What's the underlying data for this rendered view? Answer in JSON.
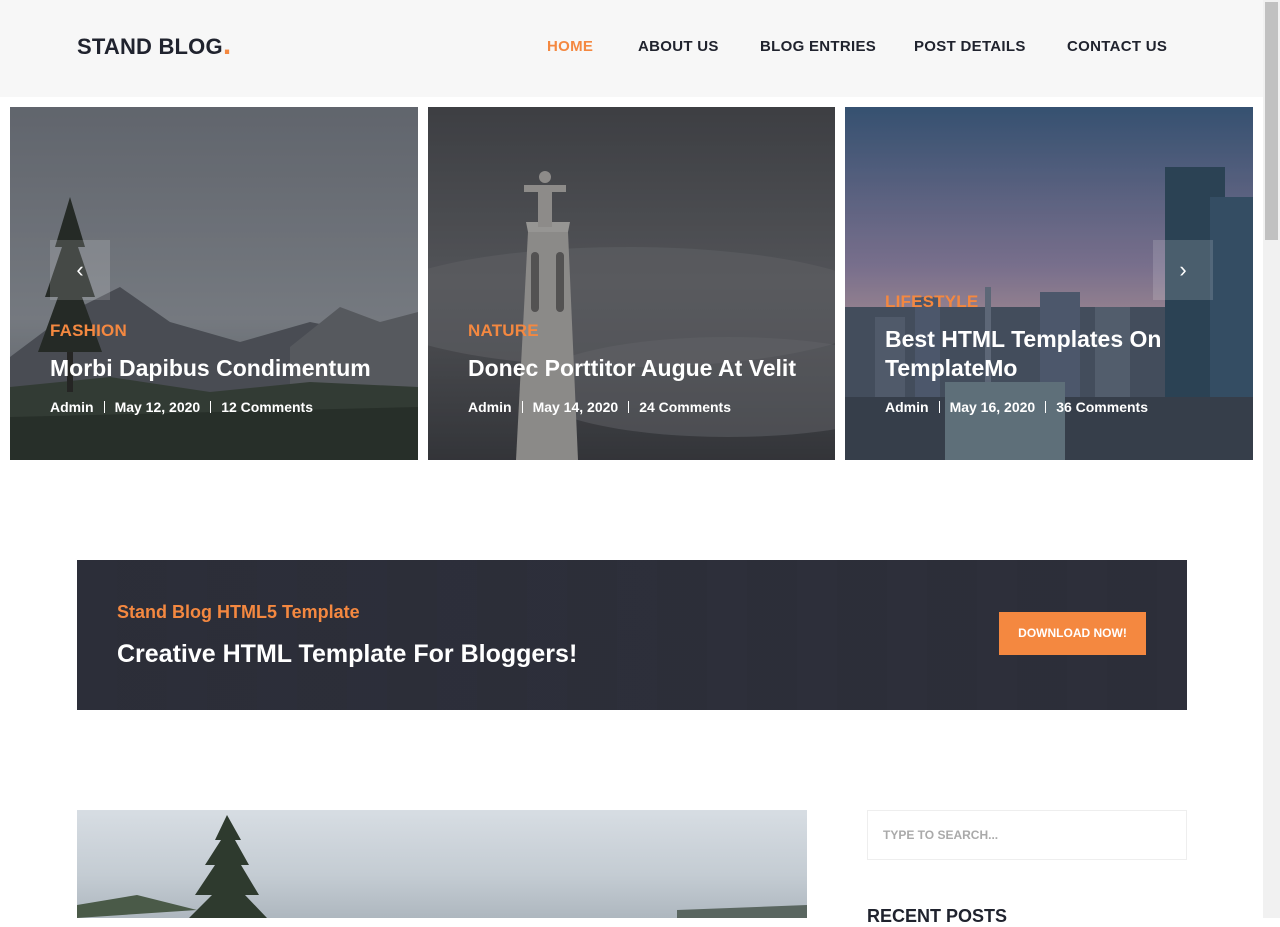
{
  "header": {
    "logo_text": "STAND BLOG",
    "logo_dot": ".",
    "nav": [
      {
        "label": "HOME",
        "active": true
      },
      {
        "label": "ABOUT US",
        "active": false
      },
      {
        "label": "BLOG ENTRIES",
        "active": false
      },
      {
        "label": "POST DETAILS",
        "active": false
      },
      {
        "label": "CONTACT US",
        "active": false
      }
    ]
  },
  "carousel": {
    "prev_symbol": "‹",
    "next_symbol": "›",
    "cards": [
      {
        "category": "FASHION",
        "title": "Morbi Dapibus Condimentum",
        "author": "Admin",
        "date": "May 12, 2020",
        "comments": "12 Comments"
      },
      {
        "category": "NATURE",
        "title": "Donec Porttitor Augue At Velit",
        "author": "Admin",
        "date": "May 14, 2020",
        "comments": "24 Comments"
      },
      {
        "category": "LIFESTYLE",
        "title": "Best HTML Templates On TemplateMo",
        "author": "Admin",
        "date": "May 16, 2020",
        "comments": "36 Comments"
      }
    ]
  },
  "banner": {
    "subtitle": "Stand Blog HTML5 Template",
    "title": "Creative HTML Template For Bloggers!",
    "button_label": "DOWNLOAD NOW!"
  },
  "sidebar": {
    "search_placeholder": "TYPE TO SEARCH...",
    "recent_heading": "RECENT POSTS"
  },
  "colors": {
    "accent": "#f48840",
    "dark": "#20232e",
    "banner_bg": "#2b2d38"
  }
}
